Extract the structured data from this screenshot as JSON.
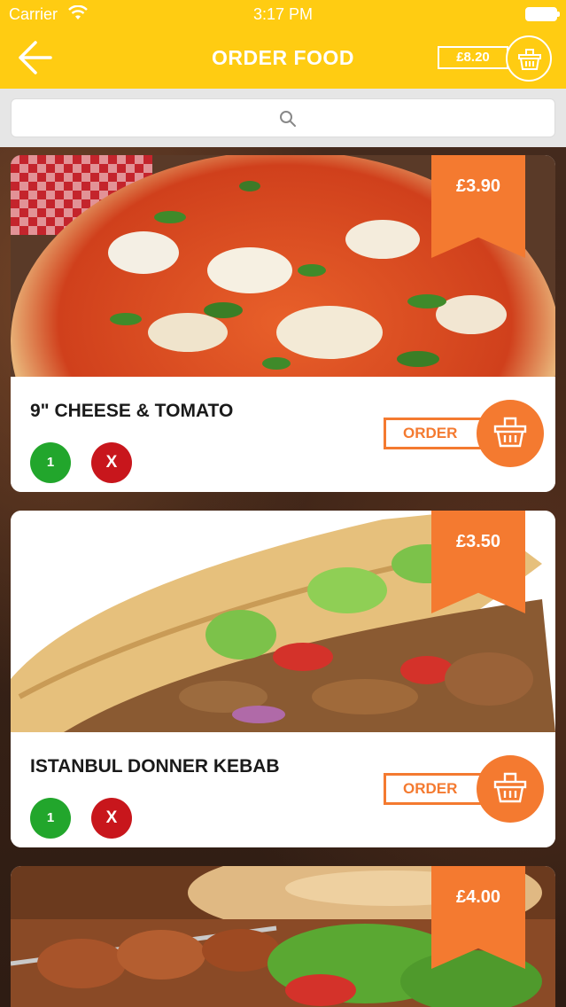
{
  "status_bar": {
    "carrier": "Carrier",
    "time": "3:17 PM"
  },
  "header": {
    "title": "ORDER FOOD",
    "cart_total": "£8.20"
  },
  "search": {
    "placeholder": ""
  },
  "items": [
    {
      "name": "9\" CHEESE & TOMATO",
      "price": "£3.90",
      "quantity": "1",
      "remove_label": "X",
      "order_label": "ORDER",
      "image": "pizza-image"
    },
    {
      "name": "ISTANBUL DONNER KEBAB",
      "price": "£3.50",
      "quantity": "1",
      "remove_label": "X",
      "order_label": "ORDER",
      "image": "kebab-image"
    },
    {
      "name": "",
      "price": "£4.00",
      "image": "skewer-image"
    }
  ],
  "colors": {
    "header": "#ffcc12",
    "accent": "#f47a30",
    "quantity": "#22a62c",
    "remove": "#c8161c"
  }
}
